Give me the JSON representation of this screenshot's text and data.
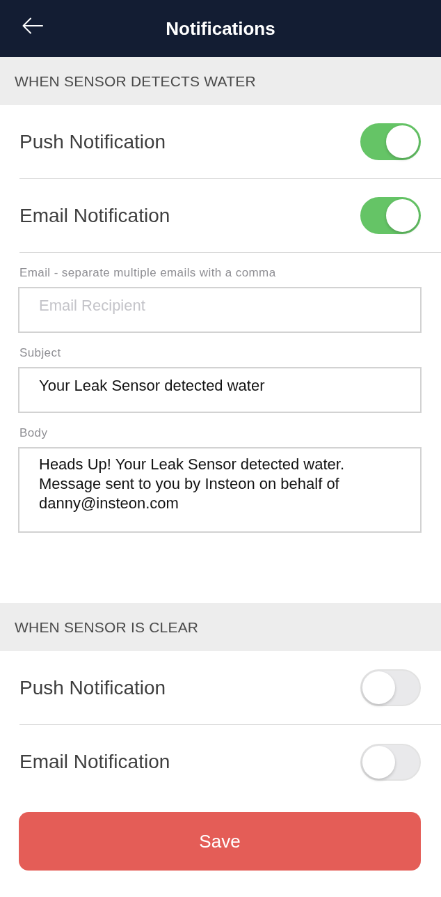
{
  "header": {
    "title": "Notifications"
  },
  "sections": [
    {
      "title": "WHEN SENSOR DETECTS WATER",
      "items": [
        {
          "kind": "toggle",
          "label": "Push Notification",
          "on": true
        },
        {
          "kind": "toggle",
          "label": "Email Notification",
          "on": true
        },
        {
          "kind": "field",
          "label": "Email - separate multiple emails with a comma",
          "placeholder": "Email Recipient"
        },
        {
          "kind": "field",
          "label": "Subject",
          "value": "Your Leak Sensor detected water"
        },
        {
          "kind": "textarea",
          "label": "Body",
          "value": "Heads Up! Your Leak Sensor detected water. Message sent to you by Insteon on behalf of danny@insteon.com"
        }
      ]
    },
    {
      "title": "WHEN SENSOR IS CLEAR",
      "items": [
        {
          "kind": "toggle",
          "label": "Push Notification",
          "on": false
        },
        {
          "kind": "toggle",
          "label": "Email Notification",
          "on": false
        }
      ]
    }
  ],
  "save_button": {
    "label": "Save"
  }
}
